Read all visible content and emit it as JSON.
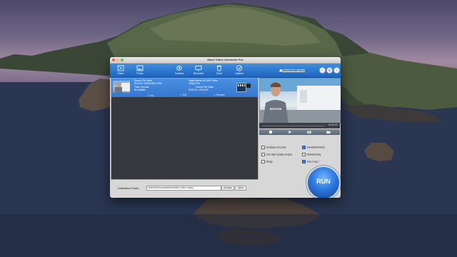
{
  "window": {
    "title": "MacX Video Converter Pro"
  },
  "toolbar": {
    "items": [
      {
        "label": "Video",
        "icon": "video-plus-icon"
      },
      {
        "label": "Photo",
        "icon": "photo-plus-icon"
      },
      {
        "label": "Camera",
        "icon": "camera-icon"
      },
      {
        "label": "Recorder",
        "icon": "recorder-icon"
      },
      {
        "label": "Clear",
        "icon": "trash-icon"
      },
      {
        "label": "Options",
        "icon": "options-icon"
      }
    ],
    "check_updates": "Check for Update",
    "right_buttons": [
      {
        "icon": "help-icon",
        "glyph": "?"
      },
      {
        "icon": "settings-gear-icon",
        "glyph": "⚙"
      },
      {
        "icon": "info-icon",
        "glyph": "i"
      }
    ]
  },
  "task": {
    "name": "Source File Video",
    "source_lines": [
      "00:10:57 1920x1080 H.264",
      "Track: 2ch aac",
      "No Subtitle"
    ],
    "target": "Target format: 4K MP4 Video",
    "output_label": "Output File:",
    "output_name": "Source File Video",
    "output_time": "00:00:00 - 00:10:57",
    "actions": [
      "Info",
      "Edit",
      "Rename"
    ]
  },
  "preview": {
    "shirt_text": "WESTEIN",
    "time": "00:00:00"
  },
  "options": {
    "hardware_encoder": {
      "label": "Hardware Encoder",
      "checked": false
    },
    "intel_nvidia": {
      "label": "Intel/AMD/Nvidia",
      "checked": true
    },
    "high_quality": {
      "label": "Use High Quality Engine",
      "checked": false
    },
    "deinterlacing": {
      "label": "Deinterlacing",
      "checked": false
    },
    "merge": {
      "label": "Merge",
      "checked": false
    },
    "auto_copy": {
      "label": "Auto Copy",
      "checked": true,
      "help": "?"
    }
  },
  "run": {
    "label": "RUN"
  },
  "destination": {
    "label": "Destination Folder:",
    "path": "/Users/Ramon/dad/Movies/Mac Video Library",
    "browse": "Browse",
    "open": "Open"
  }
}
